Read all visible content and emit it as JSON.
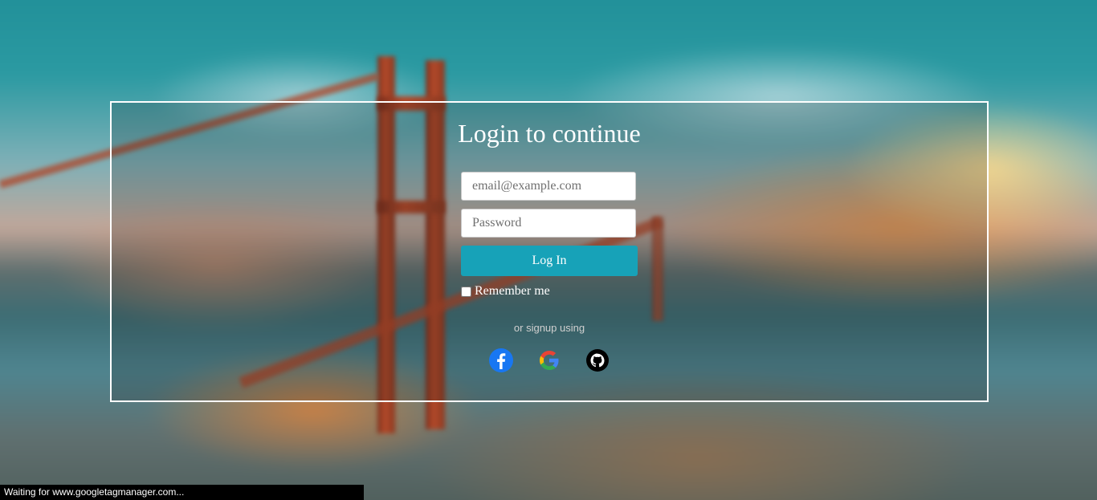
{
  "login": {
    "title": "Login to continue",
    "email_placeholder": "email@example.com",
    "email_value": "",
    "password_placeholder": "Password",
    "password_value": "",
    "login_button": "Log In",
    "remember_label": "Remember me",
    "remember_checked": false,
    "signup_text": "or signup using",
    "accent_color": "#17a2b8"
  },
  "social": {
    "providers": [
      {
        "name": "facebook-icon",
        "color": "#1877f2"
      },
      {
        "name": "google-icon",
        "colors": [
          "#4285f4",
          "#ea4335",
          "#fbbc05",
          "#34a853"
        ]
      },
      {
        "name": "github-icon",
        "color": "#000000"
      }
    ]
  },
  "browser": {
    "status_text": "Waiting for www.googletagmanager.com..."
  }
}
